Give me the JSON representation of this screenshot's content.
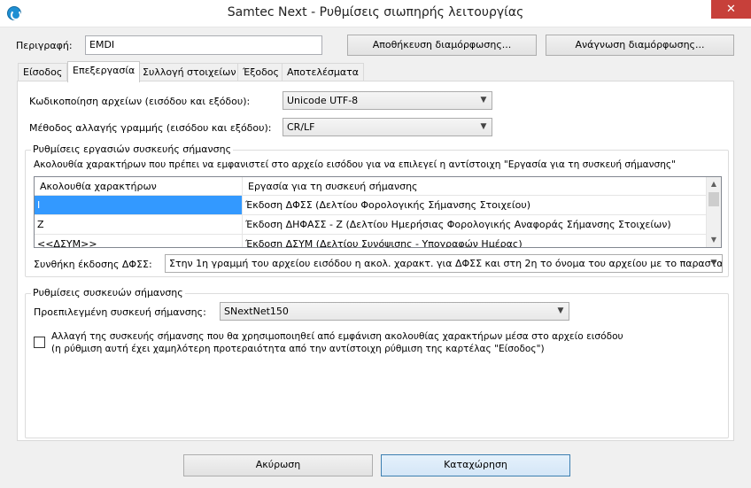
{
  "window": {
    "title": "Samtec Next - Ρυθμίσεις σιωπηρής λειτουργίας",
    "close_glyph": "✕"
  },
  "header": {
    "description_label": "Περιγραφή:",
    "description_value": "EMDI",
    "save_config_label": "Αποθήκευση διαμόρφωσης...",
    "load_config_label": "Ανάγνωση διαμόρφωσης..."
  },
  "tabs": [
    {
      "label": "Είσοδος",
      "active": false
    },
    {
      "label": "Επεξεργασία",
      "active": true
    },
    {
      "label": "Συλλογή στοιχείων",
      "active": false
    },
    {
      "label": "Έξοδος",
      "active": false
    },
    {
      "label": "Αποτελέσματα",
      "active": false
    }
  ],
  "processing": {
    "encoding_label": "Κωδικοποίηση αρχείων (εισόδου και εξόδου):",
    "encoding_value": "Unicode UTF-8",
    "newline_label": "Μέθοδος αλλαγής γραμμής (εισόδου και εξόδου):",
    "newline_value": "CR/LF",
    "tasks_group_title": "Ρυθμίσεις εργασιών συσκευής σήμανσης",
    "tasks_description": "Ακολουθία χαρακτήρων που πρέπει να εμφανιστεί στο αρχείο εισόδου για να επιλεγεί η αντίστοιχη \"Εργασία για τη συσκευή σήμανσης\"",
    "table": {
      "columns": [
        "Ακολουθία χαρακτήρων",
        "Εργασία για τη συσκευή σήμανσης"
      ],
      "rows": [
        {
          "sequence": "I",
          "task": "Έκδοση ΔΦΣΣ (Δελτίου Φορολογικής Σήμανσης Στοιχείου)",
          "selected": true
        },
        {
          "sequence": "Z",
          "task": "Έκδοση ΔΗΦΑΣΣ - Ζ (Δελτίου Ημερήσιας Φορολογικής Αναφοράς Σήμανσης Στοιχείων)",
          "selected": false
        },
        {
          "sequence": "<<ΔΣΥΜ>>",
          "task": "Έκδοση ΔΣΥΜ (Δελτίου Συνόψισης - Υπογραφών Ημέρας)",
          "selected": false
        }
      ]
    },
    "condition_label": "Συνθήκη έκδοσης ΔΦΣΣ:",
    "condition_value": "Στην 1η γραμμή του αρχείου εισόδου η ακολ. χαρακτ. για ΔΦΣΣ και στη 2η το όνομα του αρχείου με το παρασταt",
    "devices_group_title": "Ρυθμίσεις συσκευών σήμανσης",
    "default_device_label": "Προεπιλεγμένη συσκευή σήμανσης:",
    "default_device_value": "SNextNet150",
    "alt_device_line1": "Αλλαγή της συσκευής σήμανσης που θα χρησιμοποιηθεί από εμφάνιση ακολουθίας χαρακτήρων μέσα στο αρχείο εισόδου",
    "alt_device_line2": "(η ρύθμιση αυτή έχει χαμηλότερη προτεραιότητα από την αντίστοιχη ρύθμιση της καρτέλας \"Είσοδος\")",
    "alt_device_checked": false
  },
  "footer": {
    "cancel_label": "Ακύρωση",
    "submit_label": "Καταχώρηση"
  }
}
